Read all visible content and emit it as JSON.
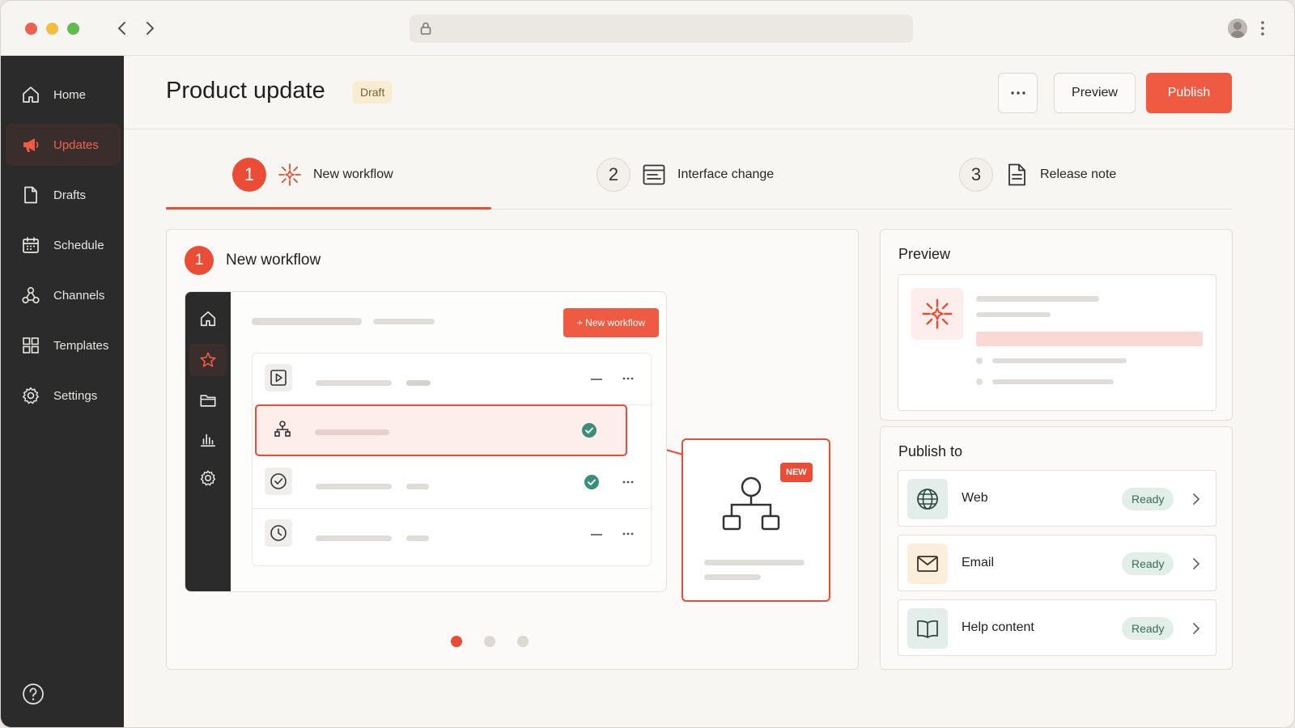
{
  "page": {
    "title": "Product update",
    "status_badge": "Draft",
    "more_label": "···",
    "preview_label": "Preview",
    "publish_label": "Publish"
  },
  "sidebar": {
    "items": [
      {
        "label": "Home",
        "icon": "home-icon",
        "active": false
      },
      {
        "label": "Updates",
        "icon": "megaphone-icon",
        "active": true
      },
      {
        "label": "Drafts",
        "icon": "document-icon",
        "active": false
      },
      {
        "label": "Schedule",
        "icon": "calendar-icon",
        "active": false
      },
      {
        "label": "Channels",
        "icon": "channels-icon",
        "active": false
      },
      {
        "label": "Templates",
        "icon": "grid-icon",
        "active": false
      },
      {
        "label": "Settings",
        "icon": "gear-icon",
        "active": false
      }
    ]
  },
  "steps": [
    {
      "number": "1",
      "label": "New workflow",
      "icon": "sparkle-icon",
      "active": true
    },
    {
      "number": "2",
      "label": "Interface change",
      "icon": "interface-icon",
      "active": false
    },
    {
      "number": "3",
      "label": "Release note",
      "icon": "document-icon",
      "active": false
    }
  ],
  "main": {
    "section_number": "1",
    "section_title": "New workflow",
    "mock_button_label": "+ New workflow",
    "callout_badge": "NEW",
    "carousel": {
      "count": 3,
      "active_index": 0
    }
  },
  "preview_card": {
    "title": "Preview"
  },
  "publish_to": {
    "title": "Publish to",
    "channels": [
      {
        "name": "Web",
        "status": "Ready",
        "icon": "globe-icon"
      },
      {
        "name": "Email",
        "status": "Ready",
        "icon": "mail-icon"
      },
      {
        "name": "Help content",
        "status": "Ready",
        "icon": "book-icon"
      }
    ]
  },
  "colors": {
    "accent": "#ea4c35",
    "sidebar_bg": "#2b2b2b",
    "ready_bg": "#e2efe9",
    "ready_text": "#3b6b58"
  }
}
